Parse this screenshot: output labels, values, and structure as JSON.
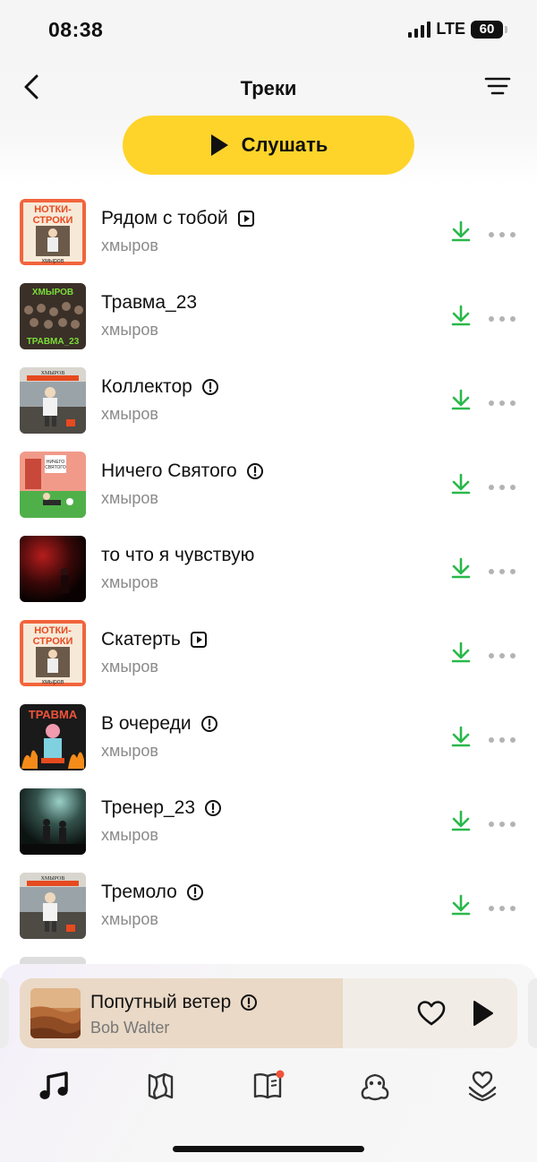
{
  "status_bar": {
    "time": "08:38",
    "network": "LTE",
    "battery": "60"
  },
  "header": {
    "title": "Треки",
    "listen_label": "Слушать"
  },
  "colors": {
    "accent": "#fed42b",
    "download": "#2ab84a",
    "muted": "#8a8a8a"
  },
  "tracks": [
    {
      "title": "Рядом с тобой",
      "artist": "хмыров",
      "badge": "video-icon",
      "cover": "nortki"
    },
    {
      "title": "Травма_23",
      "artist": "хмыров",
      "badge": "",
      "cover": "travma23"
    },
    {
      "title": "Коллектор",
      "artist": "хмыров",
      "badge": "explicit-icon",
      "cover": "khmyrov"
    },
    {
      "title": "Ничего Святого",
      "artist": "хмыров",
      "badge": "explicit-icon",
      "cover": "nichego"
    },
    {
      "title": "то что я чувствую",
      "artist": "хмыров",
      "badge": "",
      "cover": "dark-red"
    },
    {
      "title": "Скатерть",
      "artist": "хмыров",
      "badge": "video-icon",
      "cover": "nortki"
    },
    {
      "title": "В очереди",
      "artist": "хмыров",
      "badge": "explicit-icon",
      "cover": "travma-fire"
    },
    {
      "title": "Тренер_23",
      "artist": "хмыров",
      "badge": "explicit-icon",
      "cover": "concert"
    },
    {
      "title": "Тремоло",
      "artist": "хмыров",
      "badge": "explicit-icon",
      "cover": "khmyrov"
    }
  ],
  "mini_player": {
    "title": "Попутный ветер",
    "artist": "Bob Walter",
    "badge": "explicit-icon",
    "progress": 0.65
  },
  "tabs": [
    "music-note-icon",
    "map-icon",
    "book-icon",
    "kids-icon",
    "heart-hand-icon"
  ],
  "cover_texts": {
    "nortki_top": "НОТКИ-",
    "nortki_bottom": "СТРОКИ",
    "nortki_artist": "хмыров",
    "travma_top": "ХМЫРОВ",
    "travma_bottom": "ТРАВМА_23",
    "khmyrov": "ХМЫРОВ",
    "fire": "ТРАВМА"
  }
}
